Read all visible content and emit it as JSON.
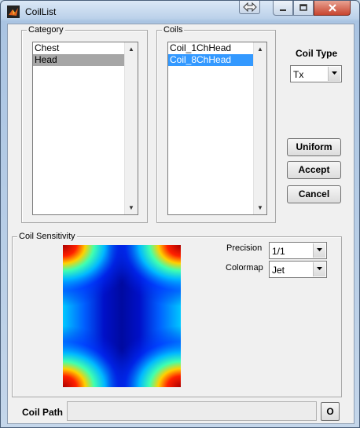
{
  "window": {
    "title": "CoilList"
  },
  "category": {
    "label": "Category",
    "items": [
      "Chest",
      "Head"
    ],
    "selected": "Head"
  },
  "coils": {
    "label": "Coils",
    "items": [
      "Coil_1ChHead",
      "Coil_8ChHead"
    ],
    "selected": "Coil_8ChHead"
  },
  "coil_type": {
    "label": "Coil Type",
    "value": "Tx"
  },
  "buttons": {
    "uniform": "Uniform",
    "accept": "Accept",
    "cancel": "Cancel",
    "open": "O"
  },
  "sensitivity": {
    "label": "Coil Sensitivity",
    "precision_label": "Precision",
    "precision_value": "1/1",
    "colormap_label": "Colormap",
    "colormap_value": "Jet"
  },
  "coil_path": {
    "label": "Coil Path",
    "value": ""
  }
}
